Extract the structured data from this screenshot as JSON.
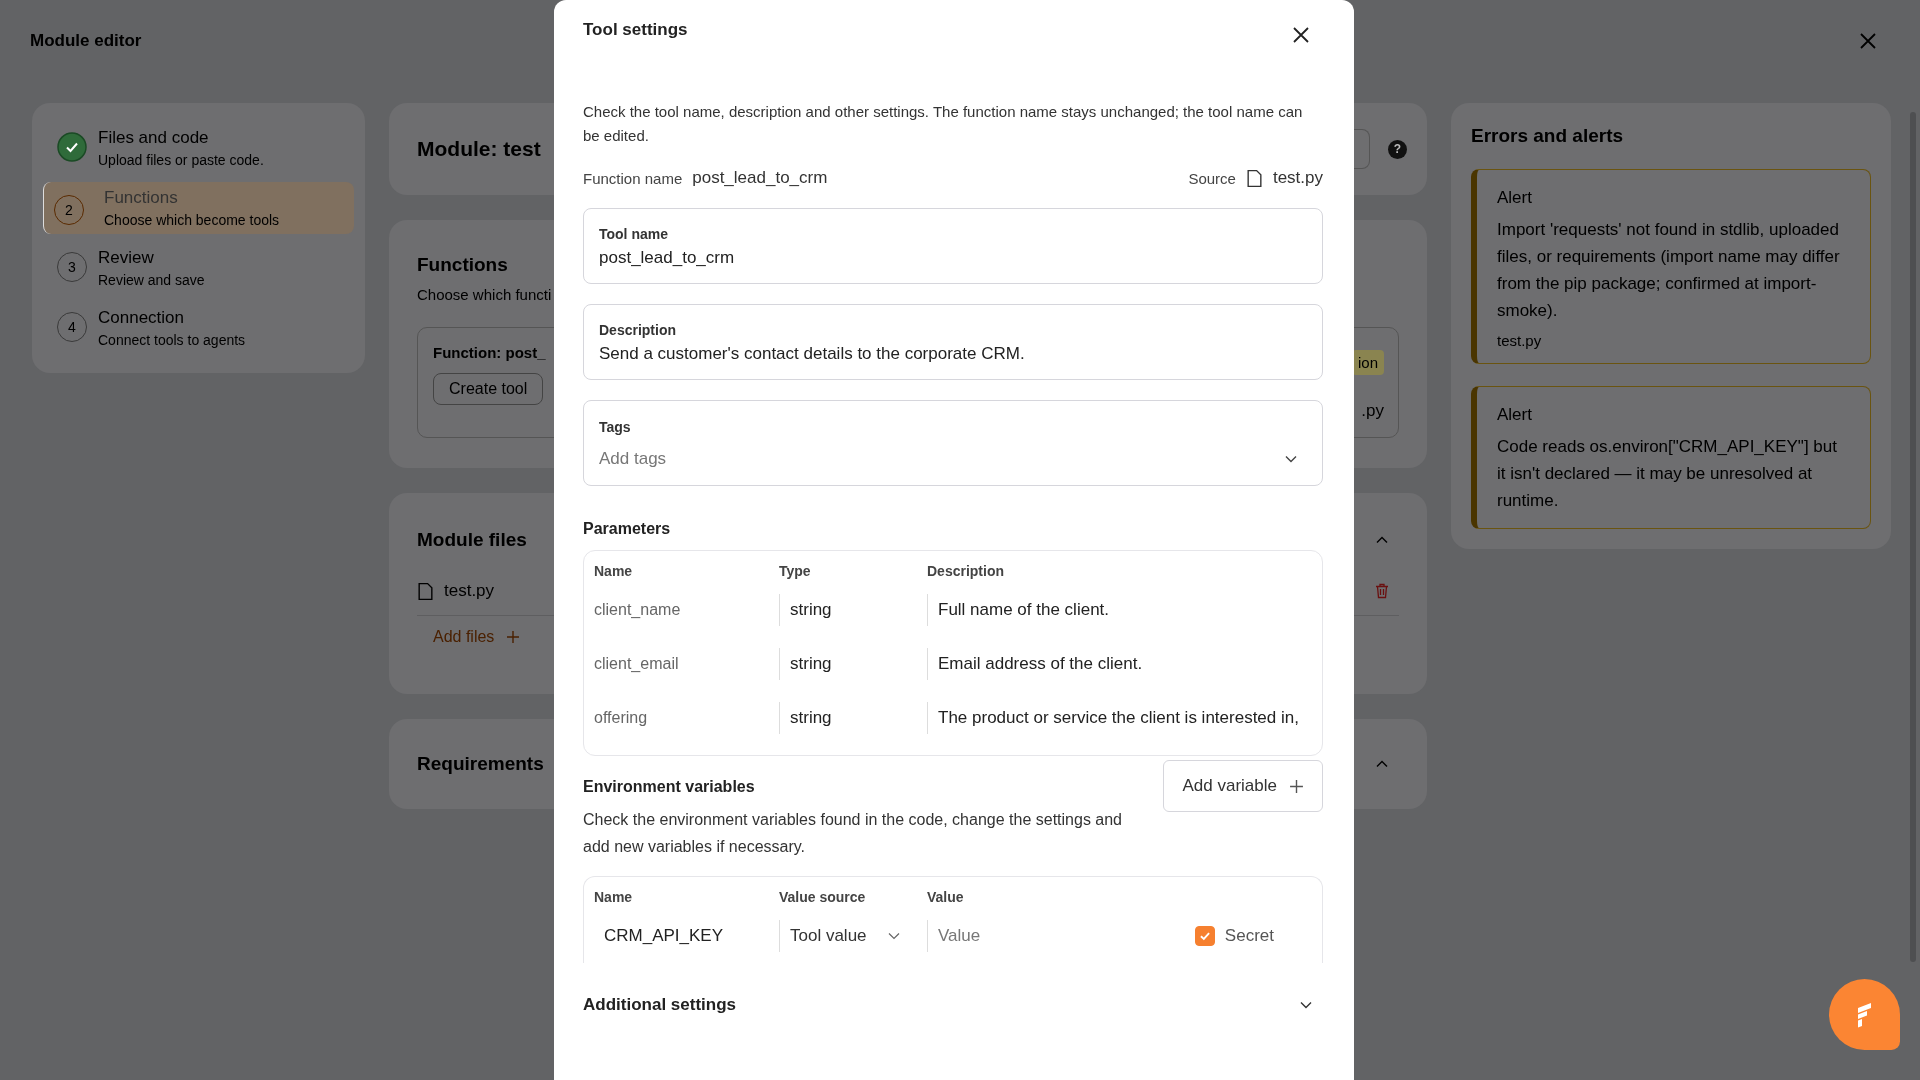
{
  "app": {
    "title": "Module editor"
  },
  "steps": [
    {
      "title": "Files and code",
      "subtitle": "Upload files or paste code.",
      "done": true,
      "selected": false
    },
    {
      "number": "2",
      "title": "Functions",
      "subtitle": "Choose which become tools",
      "done": false,
      "selected": true
    },
    {
      "number": "3",
      "title": "Review",
      "subtitle": "Review and save",
      "done": false,
      "selected": false
    },
    {
      "number": "4",
      "title": "Connection",
      "subtitle": "Connect tools to agents",
      "done": false,
      "selected": false
    }
  ],
  "module_card": {
    "title": "Module: test",
    "help_label": "?"
  },
  "functions_card": {
    "title": "Functions",
    "subtitle": "Choose which functi",
    "function_title": "Function: post_",
    "create_button": "Create tool",
    "tag": "ion",
    "file": ".py"
  },
  "files_card": {
    "title": "Module files",
    "files": [
      {
        "name": "test.py"
      }
    ],
    "add_button": "Add files"
  },
  "requirements_card": {
    "title": "Requirements"
  },
  "alerts": {
    "title": "Errors and alerts",
    "items": [
      {
        "title": "Alert",
        "message": "Import 'requests' not found in stdlib, uploaded files, or requirements (import name may differ from the pip package; confirmed at import-smoke).",
        "file": "test.py"
      },
      {
        "title": "Alert",
        "message": "Code reads os.environ[\"CRM_API_KEY\"] but it isn't declared — it may be unresolved at runtime."
      }
    ]
  },
  "dialog": {
    "title": "Tool settings",
    "intro": "Check the tool name, description and other settings. The function name stays unchanged; the tool name can be edited.",
    "function_name_label": "Function name",
    "function_name": "post_lead_to_crm",
    "source_label": "Source",
    "source_file": "test.py",
    "tool_name": {
      "label": "Tool name",
      "value": "post_lead_to_crm"
    },
    "description": {
      "label": "Description",
      "value": "Send a customer's contact details to the corporate CRM."
    },
    "tags": {
      "label": "Tags",
      "placeholder": "Add tags"
    },
    "parameters": {
      "title": "Parameters",
      "columns": [
        "Name",
        "Type",
        "Description"
      ],
      "rows": [
        {
          "name": "client_name",
          "type": "string",
          "description": "Full name of the client."
        },
        {
          "name": "client_email",
          "type": "string",
          "description": "Email address of the client."
        },
        {
          "name": "offering",
          "type": "string",
          "description": "The product or service the client is interested in,"
        }
      ]
    },
    "env": {
      "title": "Environment variables",
      "description": "Check the environment variables found in the code, change the settings and add new variables if necessary.",
      "add_button": "Add variable",
      "columns": [
        "Name",
        "Value source",
        "Value"
      ],
      "rows": [
        {
          "name": "CRM_API_KEY",
          "source": "Tool value",
          "value_placeholder": "Value",
          "secret_label": "Secret",
          "secret": true
        }
      ]
    },
    "additional": {
      "title": "Additional settings",
      "expanded": false
    }
  }
}
